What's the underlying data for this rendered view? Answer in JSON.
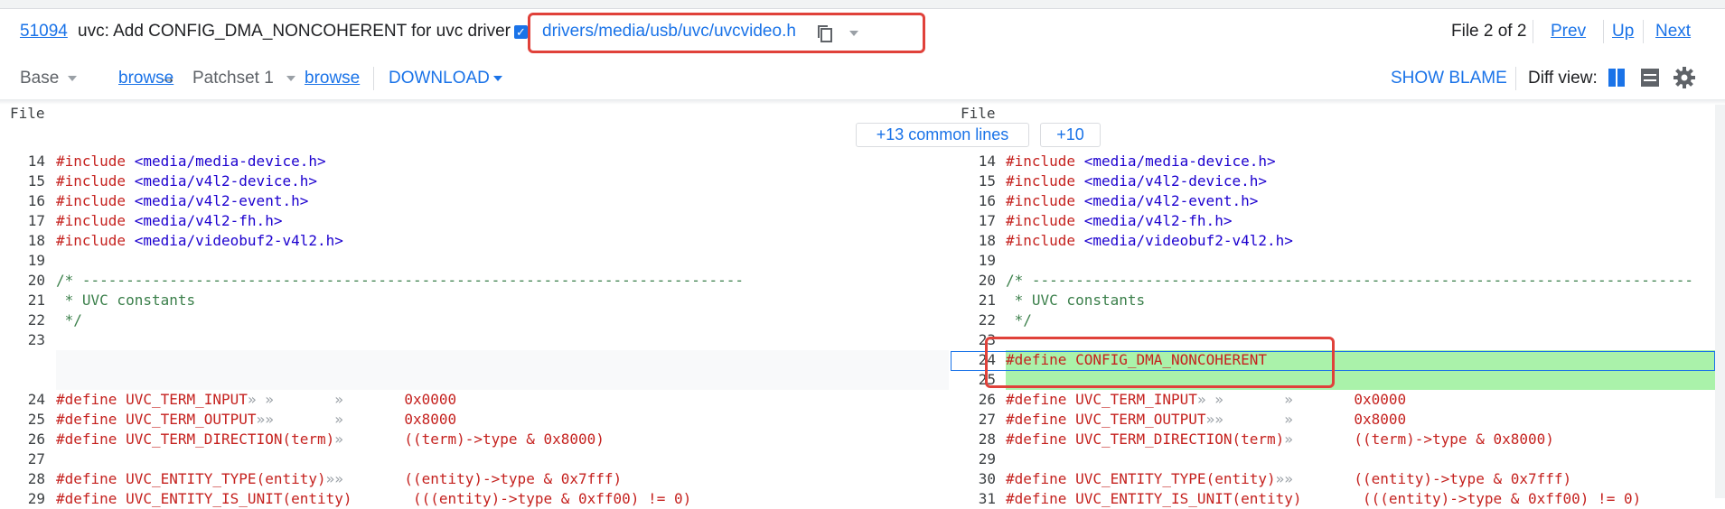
{
  "header": {
    "change_number": "51094",
    "subject": "uvc: Add CONFIG_DMA_NONCOHERENT for uvc driver",
    "file_path": "drivers/media/usb/uvc/uvcvideo.h",
    "file_position": "File 2 of 2",
    "prev_label": "Prev",
    "up_label": "Up",
    "next_label": "Next"
  },
  "toolbar": {
    "base_label": "Base",
    "base_browse": "browse",
    "arrow": "→",
    "patchset_label": "Patchset 1",
    "patchset_browse": "browse",
    "download_label": "DOWNLOAD",
    "show_blame_label": "SHOW BLAME",
    "diff_view_label": "Diff view:"
  },
  "diff": {
    "left_header": "File",
    "right_header": "File",
    "common_lines_button": "+13 common lines",
    "plus_ten_button": "+10",
    "left_lines": [
      {
        "n": "14",
        "k": "inc",
        "a": "#include",
        "b": " <media/media-device.h>"
      },
      {
        "n": "15",
        "k": "inc",
        "a": "#include",
        "b": " <media/v4l2-device.h>"
      },
      {
        "n": "16",
        "k": "inc",
        "a": "#include",
        "b": " <media/v4l2-event.h>"
      },
      {
        "n": "17",
        "k": "inc",
        "a": "#include",
        "b": " <media/v4l2-fh.h>"
      },
      {
        "n": "18",
        "k": "inc",
        "a": "#include",
        "b": " <media/videobuf2-v4l2.h>"
      },
      {
        "n": "19",
        "k": "blank",
        "a": "",
        "b": ""
      },
      {
        "n": "20",
        "k": "cmt",
        "a": "/* ----------------------------------------------------------------------------",
        "b": ""
      },
      {
        "n": "21",
        "k": "cmt",
        "a": " * UVC constants",
        "b": ""
      },
      {
        "n": "22",
        "k": "cmt",
        "a": " */",
        "b": ""
      },
      {
        "n": "23",
        "k": "blank",
        "a": "",
        "b": ""
      },
      {
        "n": "",
        "k": "gap",
        "a": "",
        "b": ""
      },
      {
        "n": "",
        "k": "gap",
        "a": "",
        "b": ""
      },
      {
        "n": "24",
        "k": "def",
        "a": "#define",
        "b": " UVC_TERM_INPUT",
        "c": "» »       »       ",
        "d": "0x0000"
      },
      {
        "n": "25",
        "k": "def",
        "a": "#define",
        "b": " UVC_TERM_OUTPUT",
        "c": "»»       »       ",
        "d": "0x8000"
      },
      {
        "n": "26",
        "k": "def",
        "a": "#define",
        "b": " UVC_TERM_DIRECTION(term)",
        "c": "»       ",
        "d": "((term)->type & 0x8000)"
      },
      {
        "n": "27",
        "k": "blank",
        "a": "",
        "b": ""
      },
      {
        "n": "28",
        "k": "def",
        "a": "#define",
        "b": " UVC_ENTITY_TYPE(entity)",
        "c": "»»       ",
        "d": "((entity)->type & 0x7fff)"
      },
      {
        "n": "29",
        "k": "def",
        "a": "#define",
        "b": " UVC_ENTITY_IS_UNIT(entity)",
        "c": "       ",
        "d": "(((entity)->type & 0xff00) != 0)"
      }
    ],
    "right_lines": [
      {
        "n": "14",
        "k": "inc",
        "a": "#include",
        "b": " <media/media-device.h>"
      },
      {
        "n": "15",
        "k": "inc",
        "a": "#include",
        "b": " <media/v4l2-device.h>"
      },
      {
        "n": "16",
        "k": "inc",
        "a": "#include",
        "b": " <media/v4l2-event.h>"
      },
      {
        "n": "17",
        "k": "inc",
        "a": "#include",
        "b": " <media/v4l2-fh.h>"
      },
      {
        "n": "18",
        "k": "inc",
        "a": "#include",
        "b": " <media/videobuf2-v4l2.h>"
      },
      {
        "n": "19",
        "k": "blank",
        "a": "",
        "b": ""
      },
      {
        "n": "20",
        "k": "cmt",
        "a": "/* ----------------------------------------------------------------------------",
        "b": ""
      },
      {
        "n": "21",
        "k": "cmt",
        "a": " * UVC constants",
        "b": ""
      },
      {
        "n": "22",
        "k": "cmt",
        "a": " */",
        "b": ""
      },
      {
        "n": "23",
        "k": "blank",
        "a": "",
        "b": ""
      },
      {
        "n": "24",
        "k": "add",
        "a": "#define",
        "b": " CONFIG_DMA_NONCOHERENT"
      },
      {
        "n": "25",
        "k": "addblank",
        "a": "",
        "b": ""
      },
      {
        "n": "26",
        "k": "def",
        "a": "#define",
        "b": " UVC_TERM_INPUT",
        "c": "» »       »       ",
        "d": "0x0000"
      },
      {
        "n": "27",
        "k": "def",
        "a": "#define",
        "b": " UVC_TERM_OUTPUT",
        "c": "»»       »       ",
        "d": "0x8000"
      },
      {
        "n": "28",
        "k": "def",
        "a": "#define",
        "b": " UVC_TERM_DIRECTION(term)",
        "c": "»       ",
        "d": "((term)->type & 0x8000)"
      },
      {
        "n": "29",
        "k": "blank",
        "a": "",
        "b": ""
      },
      {
        "n": "30",
        "k": "def",
        "a": "#define",
        "b": " UVC_ENTITY_TYPE(entity)",
        "c": "»»       ",
        "d": "((entity)->type & 0x7fff)"
      },
      {
        "n": "31",
        "k": "def",
        "a": "#define",
        "b": " UVC_ENTITY_IS_UNIT(entity)",
        "c": "       ",
        "d": "(((entity)->type & 0xff00) != 0)"
      }
    ]
  },
  "icons": {
    "copy": "copy-icon",
    "checkbox": "checkbox-checked-icon",
    "side_by_side": "side-by-side-icon",
    "unified": "unified-icon",
    "settings": "gear-icon"
  },
  "colors": {
    "accent": "#1a73e8",
    "highlight_box": "#e0413a",
    "added_line": "#aaf2aa"
  }
}
